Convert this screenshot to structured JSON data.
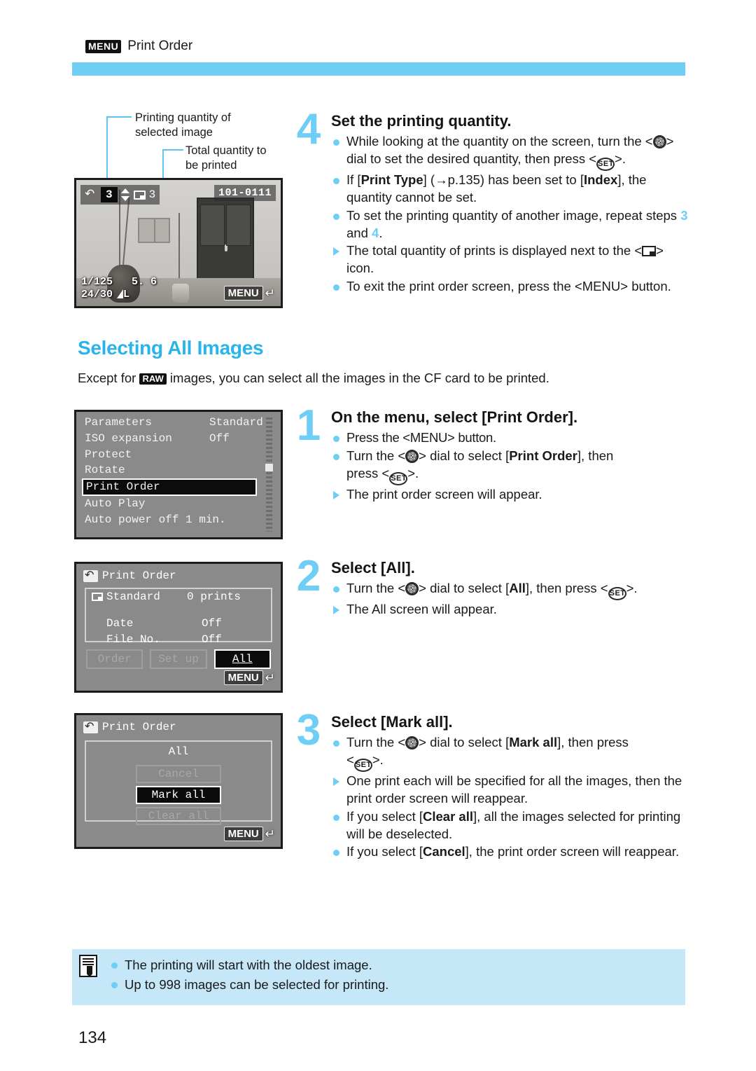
{
  "header": {
    "menu_badge": "MENU",
    "title": "Print Order"
  },
  "colors": {
    "accent_blue": "#6ecef5",
    "heading_blue": "#2ab4ec",
    "note_bg": "#c5e7f8"
  },
  "top_figure": {
    "callouts": [
      "Printing quantity of\nselected image",
      "Total quantity to\nbe printed"
    ],
    "callout1_line1": "Printing quantity of",
    "callout1_line2": "selected image",
    "callout2_line1": "Total quantity to",
    "callout2_line2": "be printed",
    "lcd": {
      "selected_quantity": "3",
      "total_quantity": "3",
      "file_number": "101-0111",
      "shutter_speed": "1/125",
      "aperture": "5. 6",
      "frame_counter": "24/30",
      "quality": "L",
      "menu_chip": "MENU"
    }
  },
  "step4": {
    "number": "4",
    "title": "Set the printing quantity.",
    "b1_a": "While looking at the quantity on the screen, turn the",
    "b1_b": "dial to set the desired quantity, then press",
    "b1_c": ">.",
    "b2_a": "If [",
    "b2_b": "Print Type",
    "b2_c": "] (→p.135) has been set to [",
    "b2_d": "Index",
    "b2_e": "], the",
    "b2_f": "quantity cannot be set.",
    "b3_a": "To set the printing quantity of another image, repeat",
    "b3_b": "steps",
    "b3_step_a": "3",
    "b3_and": "and",
    "b3_step_b": "4",
    "b4_a": "The total quantity of prints is displayed next to the",
    "b4_b": "> icon.",
    "b5_a": "To exit the print order screen, press the <MENU>",
    "b5_b": "button."
  },
  "section": {
    "heading": "Selecting All Images",
    "intro_a": "Except for",
    "intro_raw": "RAW",
    "intro_b": "images, you can select all the images in the CF card to be printed."
  },
  "menu_screen": {
    "rows": [
      {
        "label": "Parameters",
        "value": "Standard",
        "selected": false
      },
      {
        "label": "ISO expansion",
        "value": "Off",
        "selected": false
      },
      {
        "label": "Protect",
        "value": "",
        "selected": false
      },
      {
        "label": "Rotate",
        "value": "",
        "selected": false
      },
      {
        "label": "Print Order",
        "value": "",
        "selected": true
      },
      {
        "label": "Auto Play",
        "value": "",
        "selected": false
      },
      {
        "label": "Auto power off 1 min.",
        "value": "",
        "selected": false
      }
    ]
  },
  "step1": {
    "number": "1",
    "title": "On the menu, select [Print Order].",
    "b1": "Press the <MENU> button.",
    "b2_a": "Turn the <",
    "b2_b": "> dial to select [",
    "b2_bold": "Print Order",
    "b2_c": "], then",
    "b2_d": "press <",
    "b2_e": ">.",
    "b3": "The print order screen will appear."
  },
  "order_screen": {
    "title": "Print Order",
    "rows": [
      {
        "label": "Standard",
        "value": "0 prints"
      },
      {
        "label": "Date",
        "value": "Off"
      },
      {
        "label": "File No.",
        "value": "Off"
      }
    ],
    "buttons": [
      {
        "label": "Order",
        "active": false
      },
      {
        "label": "Set up",
        "active": false
      },
      {
        "label": "All",
        "active": true
      }
    ],
    "menu_chip": "MENU"
  },
  "step2": {
    "number": "2",
    "title": "Select [All].",
    "b1_a": "Turn the <",
    "b1_b": "> dial to select [",
    "b1_bold": "All",
    "b1_c": "], then press <",
    "b1_d": ">.",
    "b2": "The All screen will appear."
  },
  "all_screen": {
    "title": "Print Order",
    "dialog_title": "All",
    "buttons": [
      {
        "label": "Cancel",
        "active": false
      },
      {
        "label": "Mark all",
        "active": true
      },
      {
        "label": "Clear all",
        "active": false
      }
    ],
    "menu_chip": "MENU"
  },
  "step3": {
    "number": "3",
    "title": "Select [Mark all].",
    "b1_a": "Turn the <",
    "b1_b": "> dial to select [",
    "b1_bold": "Mark all",
    "b1_c": "], then press",
    "b1_d": ">.",
    "b2_a": "One print each will be specified for all the images,",
    "b2_b": "then the print order screen will reappear.",
    "b3_a": "If you select [",
    "b3_bold": "Clear all",
    "b3_b": "], all the images selected for",
    "b3_c": "printing will be deselected.",
    "b4_a": "If you select [",
    "b4_bold": "Cancel",
    "b4_b": "], the print order screen will",
    "b4_c": "reappear."
  },
  "note": {
    "items": [
      "The printing will start with the oldest image.",
      "Up to 998 images can be selected for printing."
    ]
  },
  "page_number": "134"
}
